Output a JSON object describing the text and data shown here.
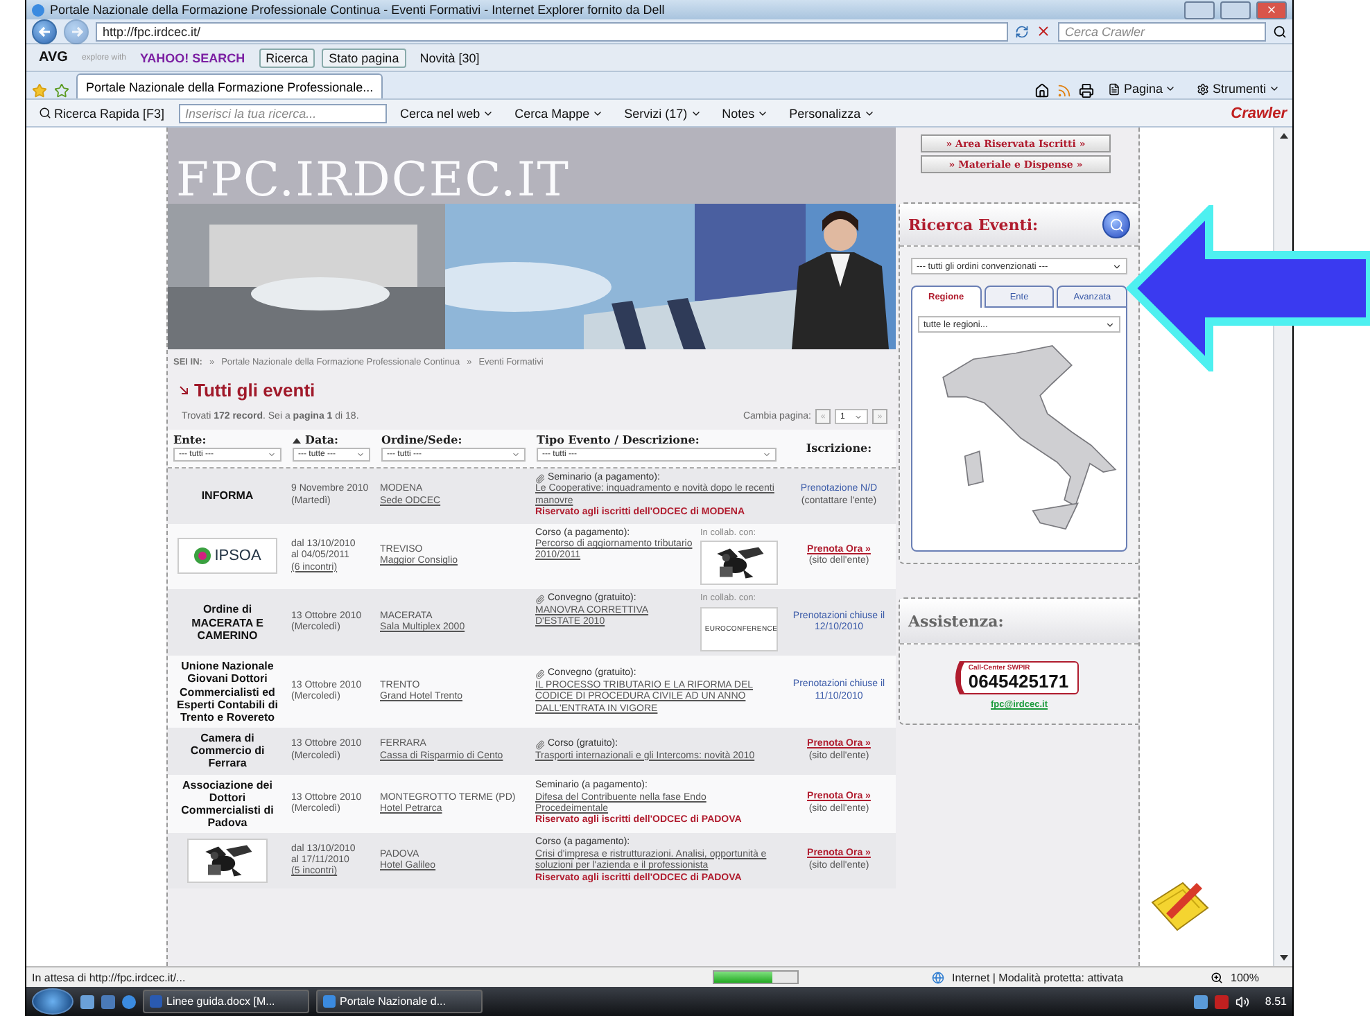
{
  "window": {
    "title": "Portale Nazionale della Formazione Professionale Continua - Eventi Formativi - Internet Explorer fornito da Dell"
  },
  "address_bar": {
    "url": "http://fpc.irdcec.it/",
    "search_placeholder": "Cerca Crawler"
  },
  "avg_toolbar": {
    "brand": "AVG",
    "explore": "explore with",
    "yahoo": "YAHOO! SEARCH",
    "buttons": [
      "Ricerca",
      "Stato pagina",
      "Novità [30]"
    ]
  },
  "tabs": [
    {
      "label": "Portale Nazionale della Formazione Professionale...",
      "selected": true
    }
  ],
  "command_bar": [
    "Pagina",
    "Strumenti"
  ],
  "crawler_toolbar": {
    "quick_search": "Ricerca Rapida [F3]",
    "placeholder": "Inserisci la tua ricerca...",
    "items": [
      "Cerca nel web",
      "Cerca Mappe",
      "Servizi (17)",
      "Notes",
      "Personalizza"
    ],
    "logo": "Crawler"
  },
  "page": {
    "site_title": "FPC.IRDCEC.IT",
    "breadcrumb": {
      "label": "SEI IN:",
      "separator": "»",
      "items": [
        "Portale Nazionale della Formazione Professionale Continua",
        "Eventi Formativi"
      ]
    },
    "heading": "Tutti gli eventi",
    "summary": "Trovati **172 record**. Sei a **pagina 1** di 18.",
    "pager": {
      "label": "Cambia pagina:",
      "prev": "«",
      "page": "1",
      "next": "»"
    },
    "columns": [
      {
        "label": "Ente:",
        "filter": "--- tutti ---",
        "sorted": false
      },
      {
        "label": "Data:",
        "filter": "--- tutte ---",
        "sorted": true
      },
      {
        "label": "Ordine/Sede:",
        "filter": "--- tutti ---",
        "sorted": false
      },
      {
        "label": "Tipo Evento / Descrizione:",
        "filter": "--- tutti ---",
        "sorted": false
      },
      {
        "label": "Iscrizione:",
        "sorted": false
      }
    ],
    "rows": [
      {
        "ente": {
          "kind": "text",
          "text": "INFORMA"
        },
        "date": [
          "9 Novembre 2010",
          "(Martedì)"
        ],
        "city": "MODENA",
        "venue": "Sede ODCEC",
        "type": "Seminario (a pagamento):",
        "attachment": true,
        "description": "Le Cooperative: inquadramento e novità dopo le recenti manovre",
        "reserved": "Riservato agli iscritti dell'ODCEC di MODENA",
        "signup": {
          "kind": "info",
          "link": "Prenotazione N/D",
          "note": "(contattare l'ente)"
        }
      },
      {
        "ente": {
          "kind": "logo",
          "text": "IPSOA"
        },
        "date": [
          "dal 13/10/2010",
          "al 04/05/2011"
        ],
        "sessions": "(6 incontri)",
        "city": "TREVISO",
        "venue": "Maggior Consiglio",
        "type": "Corso (a pagamento):",
        "attachment": false,
        "description": "Percorso di aggiornamento tributario 2010/2011",
        "collab": {
          "label": "In collab. con:",
          "logo": {
            "kind": "picture"
          }
        },
        "signup": {
          "kind": "booking",
          "link": "Prenota Ora »",
          "note": "(sito dell'ente)"
        }
      },
      {
        "ente": {
          "kind": "text",
          "text": "Ordine di MACERATA E CAMERINO"
        },
        "date": [
          "13 Ottobre 2010",
          "(Mercoledì)"
        ],
        "city": "MACERATA",
        "venue": "Sala Multiplex 2000",
        "type": "Convegno (gratuito):",
        "attachment": true,
        "description": "MANOVRA CORRETTIVA D'ESTATE 2010",
        "collab": {
          "label": "In collab. con:",
          "logo": {
            "kind": "wordmark",
            "text": "EUROCONFERENCE"
          }
        },
        "signup": {
          "kind": "closed",
          "link": "Prenotazioni chiuse il 12/10/2010"
        }
      },
      {
        "ente": {
          "kind": "text",
          "text": "Unione Nazionale Giovani Dottori Commercialisti ed Esperti Contabili di Trento e Rovereto"
        },
        "date": [
          "13 Ottobre 2010",
          "(Mercoledì)"
        ],
        "city": "TRENTO",
        "venue": "Grand Hotel Trento",
        "type": "Convegno (gratuito):",
        "attachment": true,
        "description": "IL PROCESSO TRIBUTARIO E LA RIFORMA DEL CODICE DI PROCEDURA CIVILE AD UN ANNO DALL'ENTRATA IN VIGORE",
        "signup": {
          "kind": "closed",
          "link": "Prenotazioni chiuse il 11/10/2010"
        }
      },
      {
        "ente": {
          "kind": "text",
          "text": "Camera di Commercio di Ferrara"
        },
        "date": [
          "13 Ottobre 2010",
          "(Mercoledì)"
        ],
        "city": "FERRARA",
        "venue": "Cassa di Risparmio di Cento",
        "type": "Corso (gratuito):",
        "attachment": true,
        "description": "Trasporti internazionali e gli Intercoms: novità 2010",
        "signup": {
          "kind": "booking",
          "link": "Prenota Ora »",
          "note": "(sito dell'ente)"
        }
      },
      {
        "ente": {
          "kind": "text",
          "text": "Associazione dei Dottori Commercialisti di Padova"
        },
        "date": [
          "13 Ottobre 2010",
          "(Mercoledì)"
        ],
        "city": "MONTEGROTTO TERME (PD)",
        "venue": "Hotel Petrarca",
        "type": "Seminario (a pagamento):",
        "attachment": false,
        "description": "Difesa del Contribuente nella fase Endo Procedeimentale",
        "reserved": "Riservato agli iscritti dell'ODCEC di PADOVA",
        "signup": {
          "kind": "booking",
          "link": "Prenota Ora »",
          "note": "(sito dell'ente)"
        }
      },
      {
        "ente": {
          "kind": "picture"
        },
        "date": [
          "dal 13/10/2010",
          "al 17/11/2010"
        ],
        "sessions": "(5 incontri)",
        "city": "PADOVA",
        "venue": "Hotel Galileo",
        "type": "Corso (a pagamento):",
        "attachment": false,
        "description": "Crisi d'impresa e ristrutturazioni. Analisi, opportunità e soluzioni per l'azienda e il professionista",
        "reserved": "Riservato agli iscritti dell'ODCEC di PADOVA",
        "signup": {
          "kind": "booking",
          "link": "Prenota Ora »",
          "note": "(sito dell'ente)"
        }
      }
    ]
  },
  "sidebar": {
    "links": [
      "» Area Riservata Iscritti »",
      "» Materiale e Dispense »"
    ],
    "search": {
      "title": "Ricerca Eventi:",
      "order_select": "--- tutti gli ordini convenzionati ---",
      "tabs": [
        {
          "label": "Regione",
          "selected": true
        },
        {
          "label": "Ente",
          "selected": false
        },
        {
          "label": "Avanzata",
          "selected": false
        }
      ],
      "region_select": "tutte le regioni..."
    },
    "assistance": {
      "title": "Assistenza:",
      "call_center": "Call-Center SWPIR",
      "phone": "0645425171",
      "email": "fpc@irdcec.it"
    }
  },
  "status_bar": {
    "text": "In attesa di http://fpc.irdcec.it/...",
    "progress": {
      "level": 0.7
    },
    "zone": "Internet | Modalità protetta: attivata",
    "zoom": "100%"
  },
  "taskbar": {
    "tasks": [
      "Linee guida.docx [M...",
      "Portale Nazionale d..."
    ],
    "clock": "8.51"
  }
}
